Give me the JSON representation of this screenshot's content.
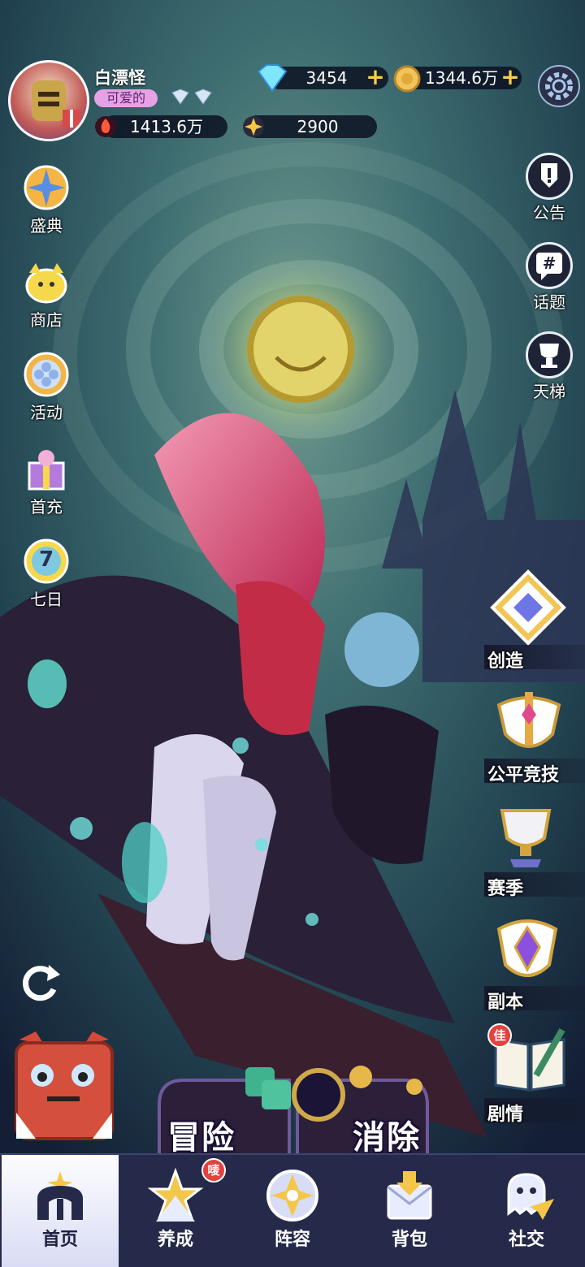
{
  "player": {
    "name": "白漂怪",
    "title_badge": "可爱的"
  },
  "resources": {
    "diamonds": "3454",
    "coins": "1344.6万",
    "power": "1413.6万",
    "stars": "2900"
  },
  "left_menu": [
    {
      "label": "盛典"
    },
    {
      "label": "商店"
    },
    {
      "label": "活动"
    },
    {
      "label": "首充"
    },
    {
      "label": "七日",
      "badge_number": "7"
    }
  ],
  "right_menu": [
    {
      "label": "公告"
    },
    {
      "label": "话题"
    },
    {
      "label": "天梯"
    }
  ],
  "modes": [
    {
      "label": "创造"
    },
    {
      "label": "公平竞技"
    },
    {
      "label": "赛季"
    },
    {
      "label": "副本"
    },
    {
      "label": "剧情",
      "tag": "佳"
    }
  ],
  "main_buttons": {
    "adventure": "冒险",
    "eliminate": "消除"
  },
  "bottom_nav": [
    {
      "label": "首页",
      "active": true
    },
    {
      "label": "养成",
      "badge": "唛"
    },
    {
      "label": "阵容"
    },
    {
      "label": "背包"
    },
    {
      "label": "社交"
    }
  ],
  "colors": {
    "nav_bg": "#252a4a",
    "active_tab": "#ffffff",
    "gold": "#f7cf4a",
    "badge_pink": "#e7a2e6",
    "badge_red": "#e4423f"
  }
}
